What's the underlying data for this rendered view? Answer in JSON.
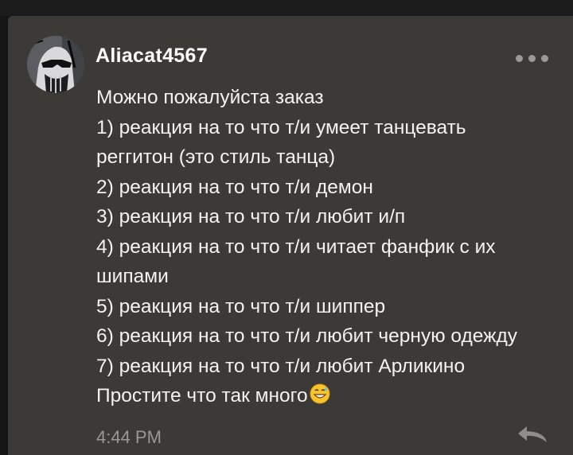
{
  "post": {
    "username": "Aliacat4567",
    "more_icon": "more-horizontal-icon",
    "message_lines": [
      "Можно пожалуйста заказ",
      "1) реакция на то что т/и умеет танцевать",
      "реггитон (это стиль танца)",
      "2) реакция на то что т/и демон",
      "3) реакция на то что т/и любит и/п",
      "4) реакция на то что т/и читает фанфик с их",
      "шипами",
      "5) реакция на то что т/и шиппер",
      "6) реакция на то что т/и любит черную одежду",
      "7) реакция на то что т/и любит Арликино",
      "Простите что так много"
    ],
    "emoji": "grinning-sweat-emoji",
    "timestamp": "4:44 PM",
    "reply_icon": "reply-arrow-icon"
  },
  "colors": {
    "page_background": "#151515",
    "card_background": "#3c3a37",
    "text": "#f4f3f1",
    "muted": "#9a9894"
  }
}
